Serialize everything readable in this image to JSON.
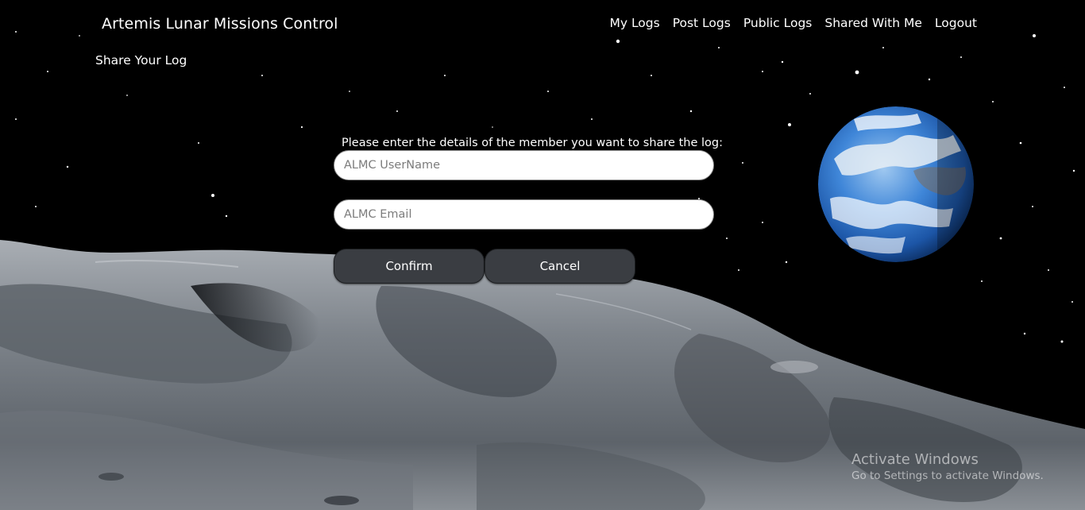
{
  "nav": {
    "brand": "Artemis Lunar Missions Control",
    "links": [
      "My Logs",
      "Post Logs",
      "Public Logs",
      "Shared With Me",
      "Logout"
    ]
  },
  "page": {
    "title": "Share Your Log"
  },
  "form": {
    "prompt": "Please enter the details of the member you want to share the log:",
    "username_placeholder": "ALMC UserName",
    "username_value": "",
    "email_placeholder": "ALMC Email",
    "email_value": "",
    "confirm_label": "Confirm",
    "cancel_label": "Cancel"
  },
  "watermark": {
    "title": "Activate Windows",
    "subtitle": "Go to Settings to activate Windows."
  },
  "colors": {
    "space": "#000000",
    "button": "#3a3d42",
    "earth_ocean": "#3f86d8",
    "moon_surface": "#8a9097"
  },
  "icons": [
    "earth-image",
    "lunar-surface-image",
    "star-field"
  ]
}
